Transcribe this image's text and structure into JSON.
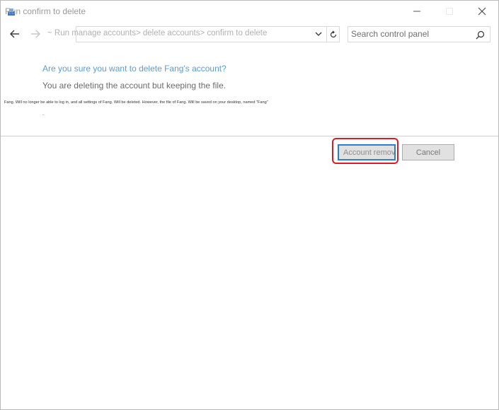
{
  "window": {
    "title": "Run confirm to delete",
    "controls": {
      "minimize": "—",
      "maximize": "☐",
      "close": "✕"
    }
  },
  "navigation": {
    "address_text": "~ Run manage accounts> delete accounts> confirm to delete",
    "search_placeholder": "Search control panel"
  },
  "content": {
    "question": "Are you sure you want to delete Fang's account?",
    "subtext": "You are deleting the account but keeping the file.",
    "detail": "Fang. Will no longer be able to log in, and all settings of Fang. Will be deleted. However, the file of Fang. Will be saved on your desktop, named \"Fang\"",
    "detail_dot": "."
  },
  "buttons": {
    "remove_label": "Account removal",
    "cancel_label": "Cancel"
  },
  "colors": {
    "link_blue": "#5b9bd5",
    "focus_blue": "#2a7fd4",
    "highlight_red": "#e01a22"
  }
}
